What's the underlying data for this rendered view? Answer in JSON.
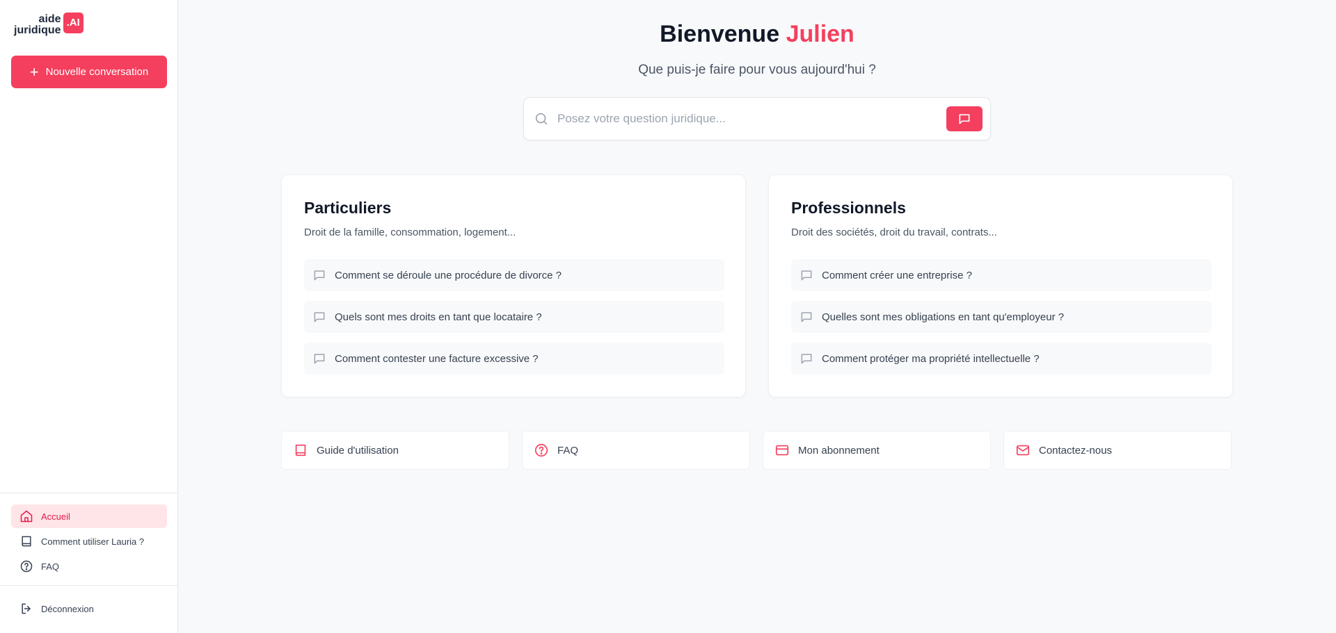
{
  "brand": {
    "line1": "aide",
    "line2": "juridique",
    "badge": ".AI",
    "accent_color": "#f43f5e"
  },
  "sidebar": {
    "new_conversation_label": "Nouvelle conversation",
    "nav": [
      {
        "label": "Accueil",
        "icon": "home-icon",
        "active": true
      },
      {
        "label": "Comment utiliser Lauria ?",
        "icon": "book-icon",
        "active": false
      },
      {
        "label": "FAQ",
        "icon": "help-circle-icon",
        "active": false
      }
    ],
    "logout_label": "Déconnexion"
  },
  "header": {
    "greeting": "Bienvenue",
    "user_name": "Julien",
    "subtitle": "Que puis-je faire pour vous aujourd'hui ?"
  },
  "search": {
    "placeholder": "Posez votre question juridique..."
  },
  "cards": [
    {
      "title": "Particuliers",
      "description": "Droit de la famille, consommation, logement...",
      "questions": [
        "Comment se déroule une procédure de divorce ?",
        "Quels sont mes droits en tant que locataire ?",
        "Comment contester une facture excessive ?"
      ]
    },
    {
      "title": "Professionnels",
      "description": "Droit des sociétés, droit du travail, contrats...",
      "questions": [
        "Comment créer une entreprise ?",
        "Quelles sont mes obligations en tant qu'employeur ?",
        "Comment protéger ma propriété intellectuelle ?"
      ]
    }
  ],
  "links": [
    {
      "label": "Guide d'utilisation",
      "icon": "book-icon"
    },
    {
      "label": "FAQ",
      "icon": "help-circle-icon"
    },
    {
      "label": "Mon abonnement",
      "icon": "credit-card-icon"
    },
    {
      "label": "Contactez-nous",
      "icon": "mail-icon"
    }
  ]
}
